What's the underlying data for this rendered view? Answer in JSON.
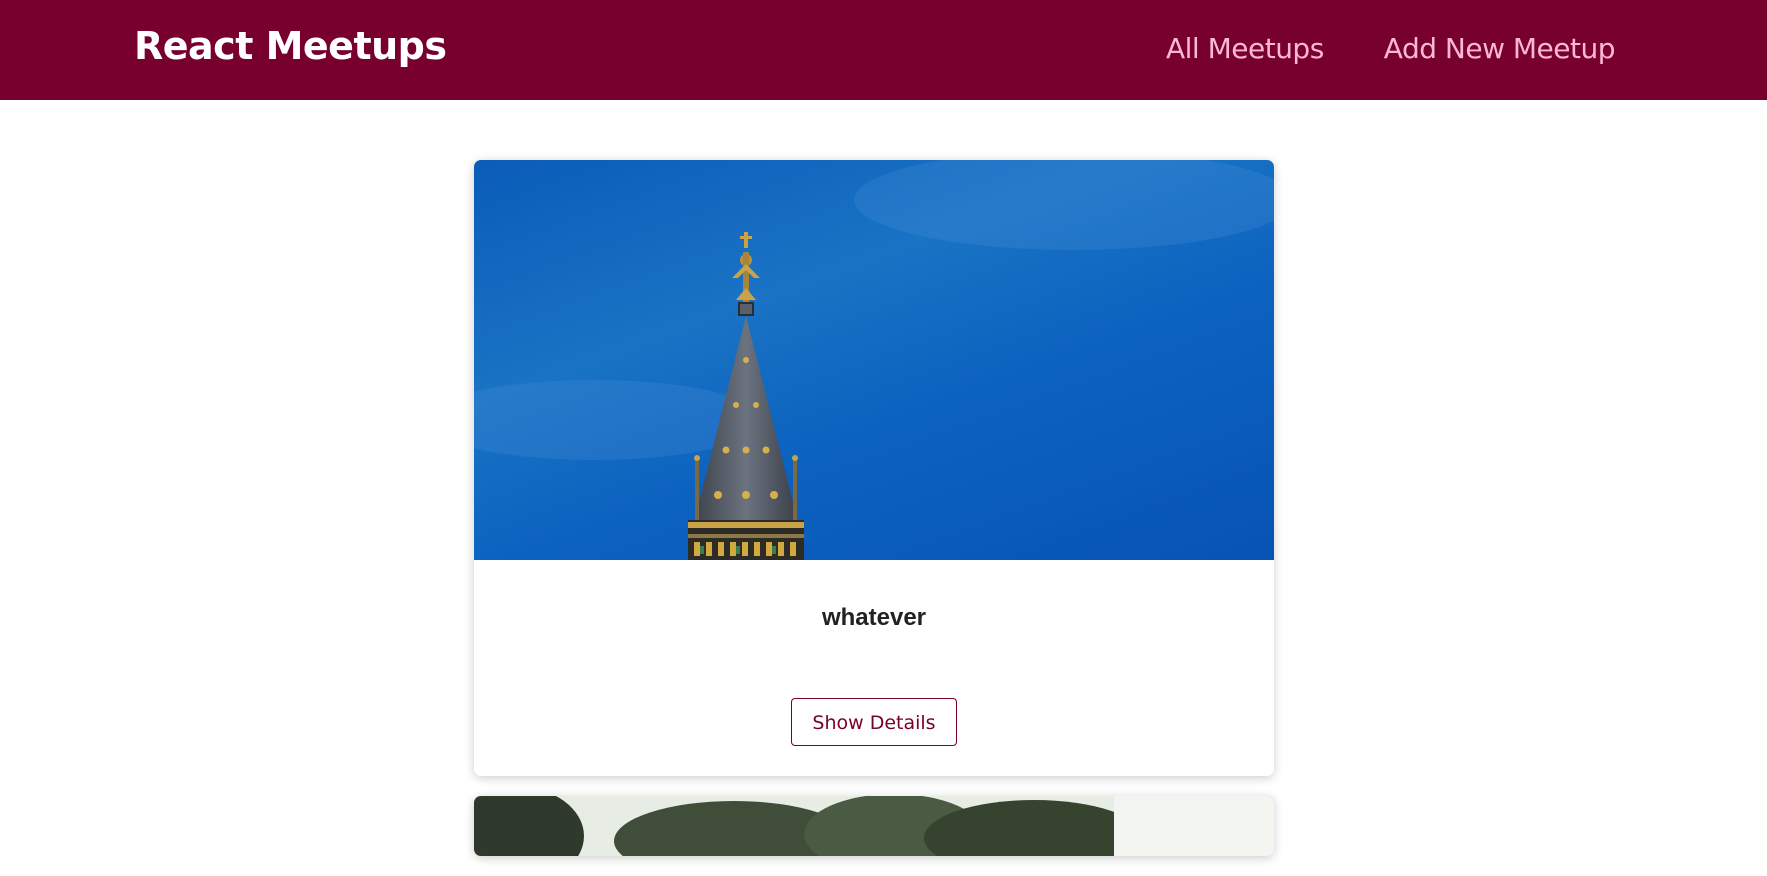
{
  "header": {
    "logo": "React Meetups",
    "nav": [
      {
        "label": "All Meetups"
      },
      {
        "label": "Add New Meetup"
      }
    ]
  },
  "meetups": [
    {
      "title": "whatever",
      "action_label": "Show Details",
      "image_alt": "spire-against-blue-sky"
    },
    {
      "image_alt": "trees-photo"
    }
  ],
  "colors": {
    "header_bg": "#77002e",
    "nav_link": "#fcb8d2",
    "accent": "#77002e"
  }
}
